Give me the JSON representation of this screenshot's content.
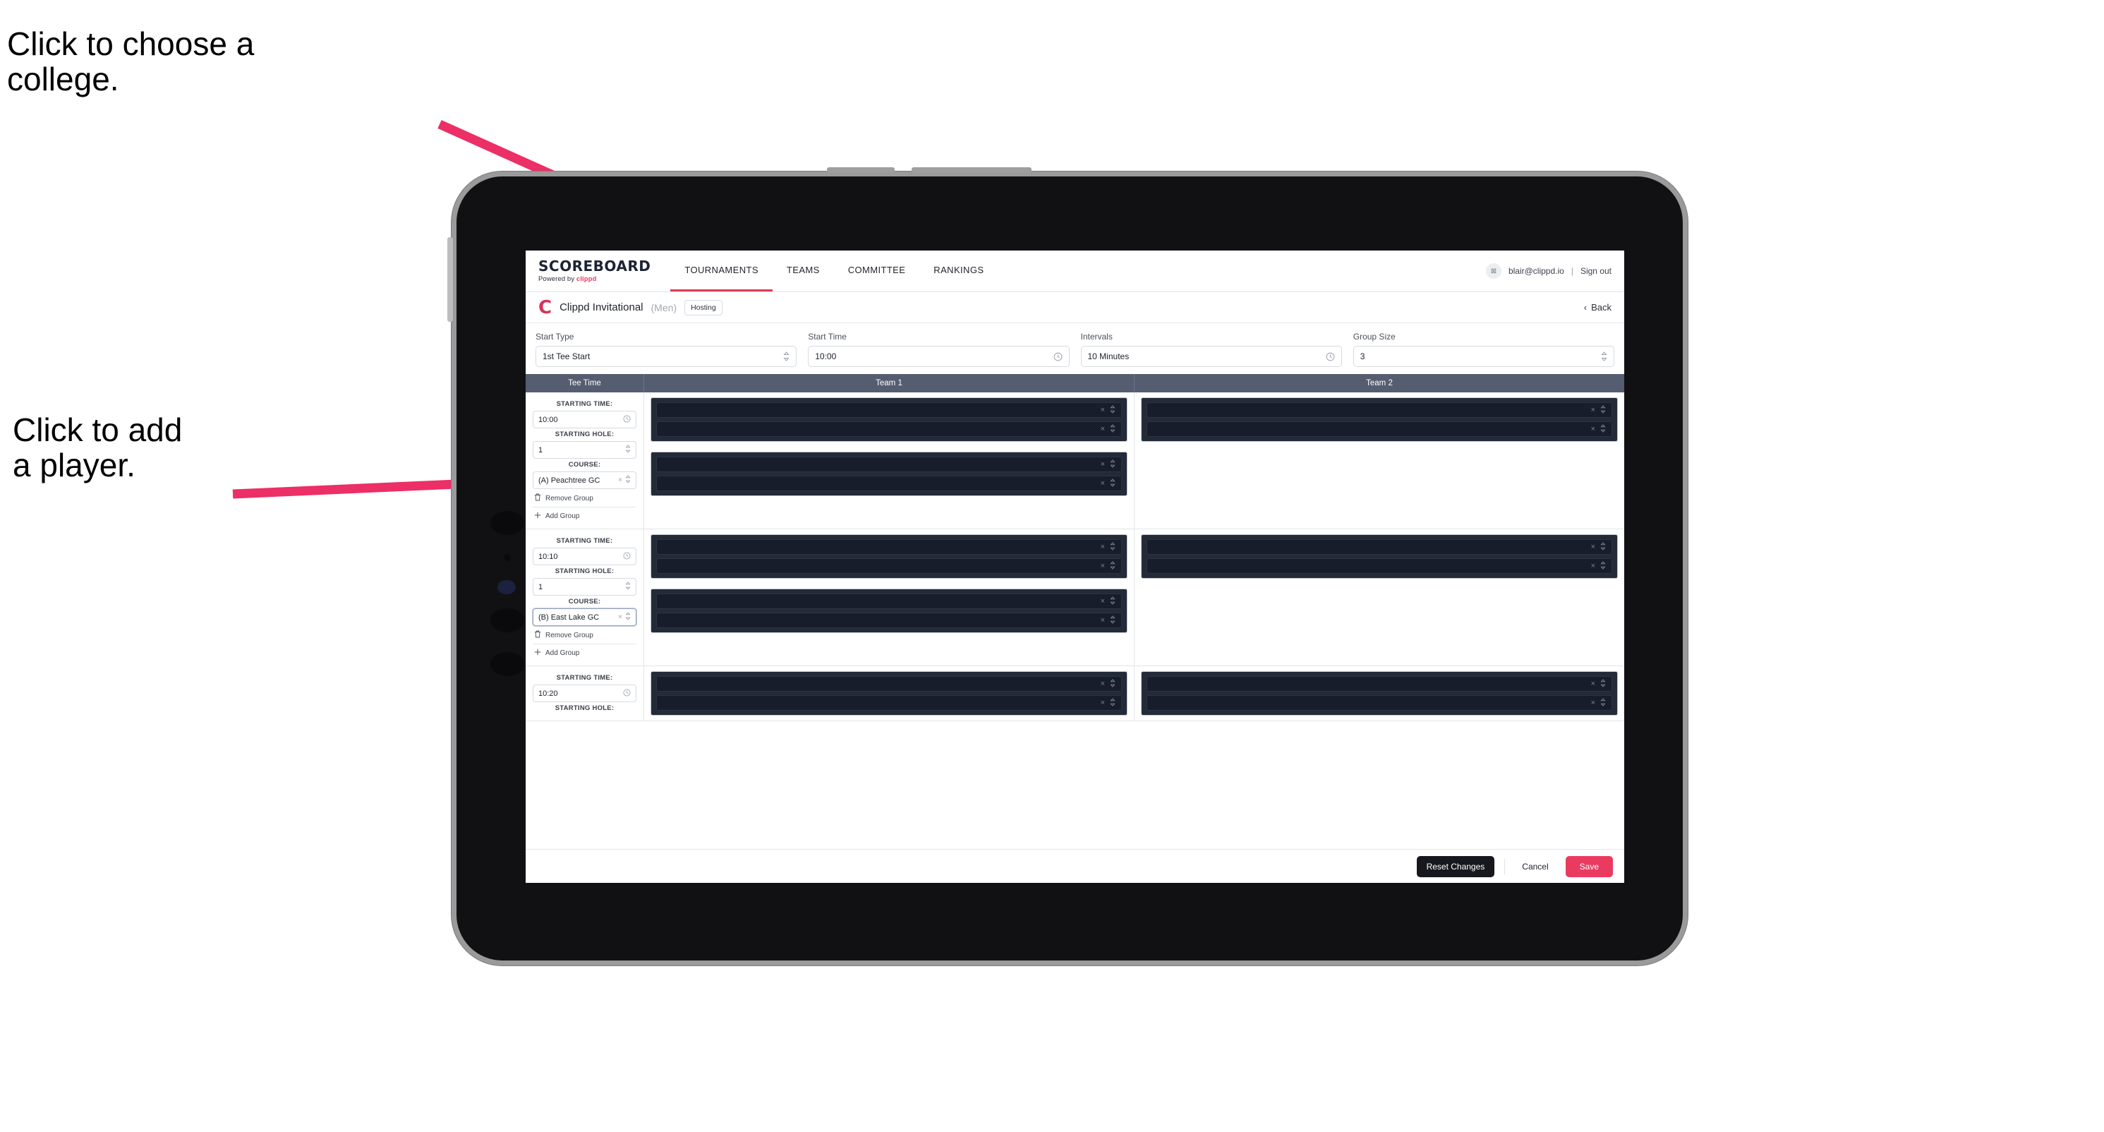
{
  "annotations": [
    {
      "id": "annot-college",
      "text": "Click to choose a\ncollege."
    },
    {
      "id": "annot-player",
      "text": "Click to add\na player."
    }
  ],
  "colors": {
    "accent": "#ea3a60",
    "arrow": "#ec2f66",
    "header_band": "#555d70",
    "dark_group": "#232a38",
    "dark_row": "#171d2a"
  },
  "topnav": {
    "brand_title": "SCOREBOARD",
    "brand_sub_prefix": "Powered by ",
    "brand_sub_brand": "clippd",
    "items": [
      {
        "label": "TOURNAMENTS",
        "active": true
      },
      {
        "label": "TEAMS",
        "active": false
      },
      {
        "label": "COMMITTEE",
        "active": false
      },
      {
        "label": "RANKINGS",
        "active": false
      }
    ],
    "avatar_glyph": "⊠",
    "email": "blair@clippd.io",
    "separator": "|",
    "signout": "Sign out"
  },
  "titlebar": {
    "logo": "C",
    "tournament": "Clippd Invitational",
    "gender": "(Men)",
    "badge": "Hosting",
    "back_chevron": "‹",
    "back_label": "Back"
  },
  "controls": [
    {
      "label": "Start Type",
      "value": "1st Tee Start",
      "icon": "stepper-icon"
    },
    {
      "label": "Start Time",
      "value": "10:00",
      "icon": "clock-icon"
    },
    {
      "label": "Intervals",
      "value": "10 Minutes",
      "icon": "clock-icon"
    },
    {
      "label": "Group Size",
      "value": "3",
      "icon": "stepper-icon"
    }
  ],
  "table": {
    "headers": [
      "Tee Time",
      "Team 1",
      "Team 2"
    ],
    "field_labels": {
      "starting_time": "STARTING TIME:",
      "starting_hole": "STARTING HOLE:",
      "course": "COURSE:"
    },
    "group_actions": {
      "remove": "Remove Group",
      "add": "Add Group",
      "remove_icon": "trash-icon",
      "add_icon": "plus-icon"
    },
    "row_icons": {
      "clear": "×",
      "stepper": "↕"
    },
    "rows": [
      {
        "starting_time": "10:00",
        "starting_hole": "1",
        "course": "(A) Peachtree GC",
        "course_focused": false,
        "show_group_actions": true,
        "team1_groups": [
          {
            "players": [
              "",
              ""
            ]
          },
          {
            "players": [
              "",
              ""
            ]
          }
        ],
        "team2_groups": [
          {
            "players": [
              "",
              ""
            ]
          }
        ]
      },
      {
        "starting_time": "10:10",
        "starting_hole": "1",
        "course": "(B) East Lake GC",
        "course_focused": true,
        "show_group_actions": true,
        "team1_groups": [
          {
            "players": [
              "",
              ""
            ]
          },
          {
            "players": [
              "",
              ""
            ]
          }
        ],
        "team2_groups": [
          {
            "players": [
              "",
              ""
            ]
          }
        ]
      },
      {
        "starting_time": "10:20",
        "starting_hole": "",
        "course": "",
        "course_focused": false,
        "show_group_actions": false,
        "partial": true,
        "team1_groups": [
          {
            "players": [
              "",
              ""
            ]
          }
        ],
        "team2_groups": [
          {
            "players": [
              "",
              ""
            ]
          }
        ]
      }
    ]
  },
  "footer": {
    "reset": "Reset Changes",
    "cancel": "Cancel",
    "save": "Save"
  }
}
